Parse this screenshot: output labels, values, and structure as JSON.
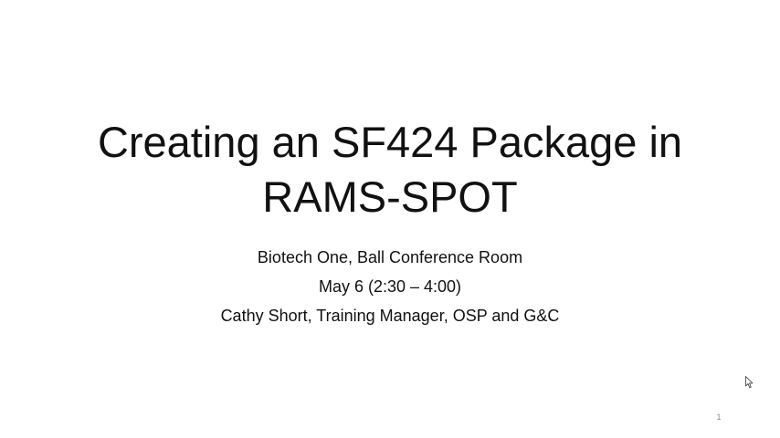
{
  "slide": {
    "title_lines": [
      "Creating an SF424 Package in",
      "RAMS-SPOT"
    ],
    "subtitle_lines": [
      "Biotech One, Ball Conference Room",
      "May 6 (2:30 – 4:00)",
      "Cathy Short, Training Manager, OSP and G&C"
    ],
    "page_number": "1"
  },
  "pointer": {
    "icon": "mouse-pointer-icon"
  }
}
